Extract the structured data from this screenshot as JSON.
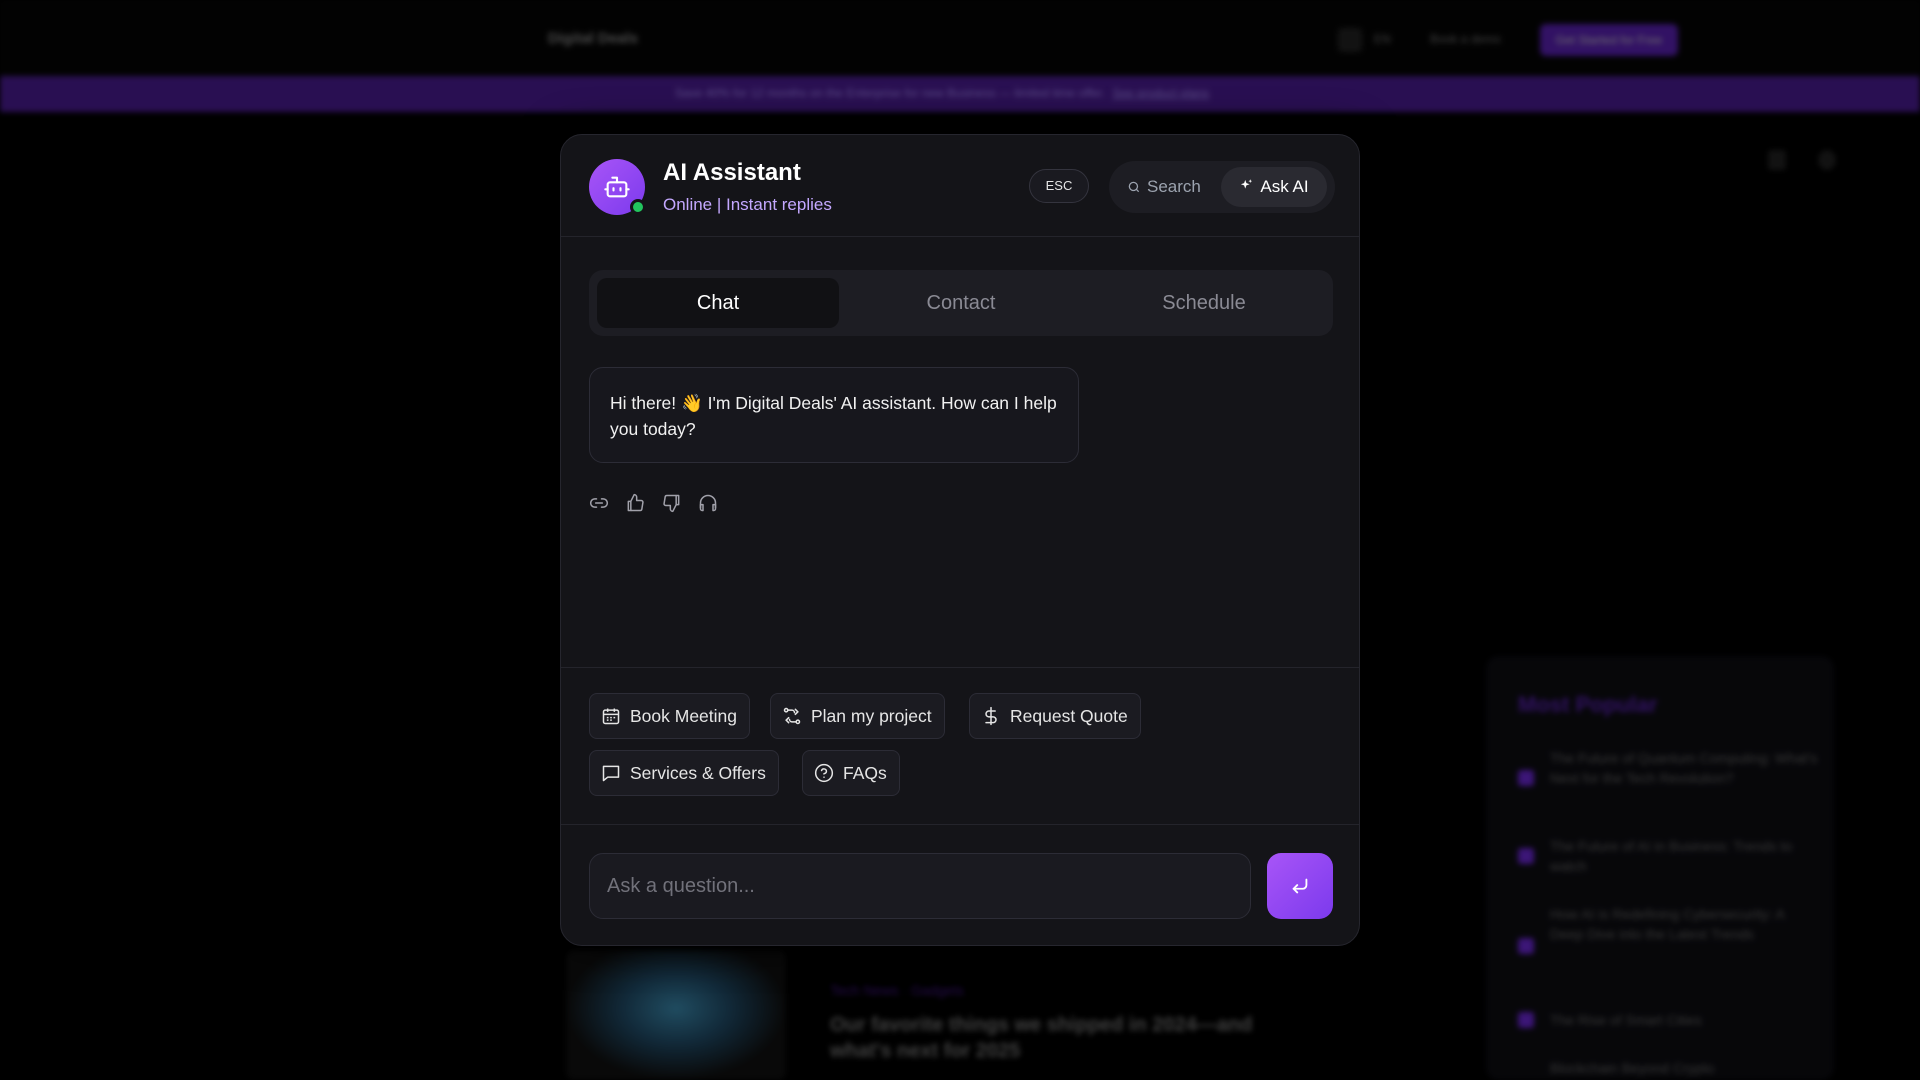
{
  "background": {
    "logo": "Digital Deals",
    "nav_lang": "EN",
    "nav_book": "Book a demo",
    "nav_cta": "Get Started for Free",
    "banner_text": "Save 40% for 12 months on the Enterprise for new Business — limited time offer.",
    "banner_link": "See product plans",
    "sidebar_title": "Most Popular",
    "sidebar_items": [
      "The Future of Quantum Computing: What's Next for the Tech Revolution?",
      "The Future of AI in Business: Trends to watch",
      "How AI is Redefining Cybersecurity: A Deep Dive into the Latest Trends",
      "The Rise of Smart Cities",
      "Blockchain Beyond Crypto"
    ],
    "card_tags": "Tech News · Gadgets",
    "card_title": "Our favorite things we shipped in 2024—and what's next for 2025"
  },
  "assistant": {
    "title": "AI Assistant",
    "subtitle": "Online | Instant replies",
    "esc_label": "ESC",
    "search_label": "Search",
    "ask_ai_label": "Ask AI",
    "tabs": [
      {
        "label": "Chat",
        "active": true
      },
      {
        "label": "Contact",
        "active": false
      },
      {
        "label": "Schedule",
        "active": false
      }
    ],
    "greeting": "Hi there! 👋 I'm Digital Deals' AI assistant. How can I help you today?",
    "message_actions": [
      "link-icon",
      "thumbs-up-icon",
      "thumbs-down-icon",
      "headphones-icon"
    ],
    "chips": [
      {
        "label": "Book Meeting",
        "icon": "calendar-icon"
      },
      {
        "label": "Plan my project",
        "icon": "workflow-icon"
      },
      {
        "label": "Request Quote",
        "icon": "dollar-icon"
      },
      {
        "label": "Services & Offers",
        "icon": "message-icon"
      },
      {
        "label": "FAQs",
        "icon": "help-circle-icon"
      }
    ],
    "input_placeholder": "Ask a question...",
    "colors": {
      "accent": "#8b5cf6",
      "online": "#22c55e",
      "subtitle": "#c4a8ff"
    }
  }
}
